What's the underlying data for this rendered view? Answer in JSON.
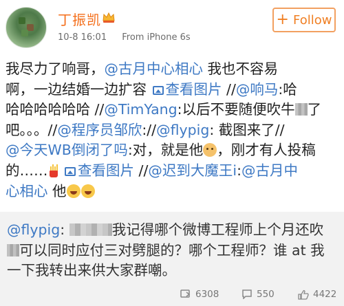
{
  "post": {
    "user": {
      "name": "丁振凯",
      "avatar_icon": "avatar-image",
      "badge_icon": "crown-icon"
    },
    "meta": {
      "time": "10-8 16:01",
      "source": "From iPhone 6s"
    },
    "follow_button": {
      "label": "Follow"
    },
    "body_lines": [
      [
        {
          "t": "text",
          "v": "我尽力了响哥，"
        },
        {
          "t": "link",
          "v": "@古月中心相心"
        },
        {
          "t": "text",
          "v": " 我也不容易"
        }
      ],
      [
        {
          "t": "text",
          "v": "啊，一边结婚一边扩容 "
        },
        {
          "t": "img",
          "v": "查看图片"
        },
        {
          "t": "text",
          "v": " //"
        },
        {
          "t": "link",
          "v": "@响马"
        },
        {
          "t": "text",
          "v": ":哈"
        }
      ],
      [
        {
          "t": "text",
          "v": "哈哈哈哈哈哈 //"
        },
        {
          "t": "link",
          "v": "@TimYang"
        },
        {
          "t": "text",
          "v": ":以后不要随便吹牛"
        },
        {
          "t": "mosaic"
        },
        {
          "t": "text",
          "v": "了"
        }
      ],
      [
        {
          "t": "text",
          "v": "吧。。。//"
        },
        {
          "t": "link",
          "v": "@程序员邹欣"
        },
        {
          "t": "text",
          "v": "://"
        },
        {
          "t": "link",
          "v": "@flypig"
        },
        {
          "t": "text",
          "v": ": 截图来了//"
        }
      ],
      [
        {
          "t": "link",
          "v": "@今天WB倒闭了吗"
        },
        {
          "t": "text",
          "v": ":对，就是他"
        },
        {
          "t": "emoji",
          "v": "dog"
        },
        {
          "t": "text",
          "v": "，刚才有人投稿"
        }
      ],
      [
        {
          "t": "text",
          "v": "的……"
        },
        {
          "t": "emoji",
          "v": "fries"
        },
        {
          "t": "text",
          "v": " "
        },
        {
          "t": "img",
          "v": "查看图片"
        },
        {
          "t": "text",
          "v": " //"
        },
        {
          "t": "link",
          "v": "@迟到大魔王i"
        },
        {
          "t": "text",
          "v": ":"
        },
        {
          "t": "link",
          "v": "@古月中"
        }
      ],
      [
        {
          "t": "link",
          "v": "心相心"
        },
        {
          "t": "text",
          "v": " 他"
        },
        {
          "t": "emoji",
          "v": "laugh"
        },
        {
          "t": "emoji",
          "v": "laugh"
        }
      ]
    ],
    "repost": {
      "lines": [
        [
          {
            "t": "link",
            "v": "@flypig"
          },
          {
            "t": "text",
            "v": ": "
          },
          {
            "t": "mosaic-wide"
          },
          {
            "t": "text",
            "v": "我记得哪个微博工程师上个月还吹"
          }
        ],
        [
          {
            "t": "mosaic"
          },
          {
            "t": "text",
            "v": "可以同时应付三对劈腿的？哪个工程师？谁 at 我"
          }
        ],
        [
          {
            "t": "text",
            "v": "一下我转出来供大家群嘲。"
          }
        ]
      ]
    },
    "stats": {
      "reposts": "6308",
      "comments": "550",
      "likes": "4422"
    }
  }
}
